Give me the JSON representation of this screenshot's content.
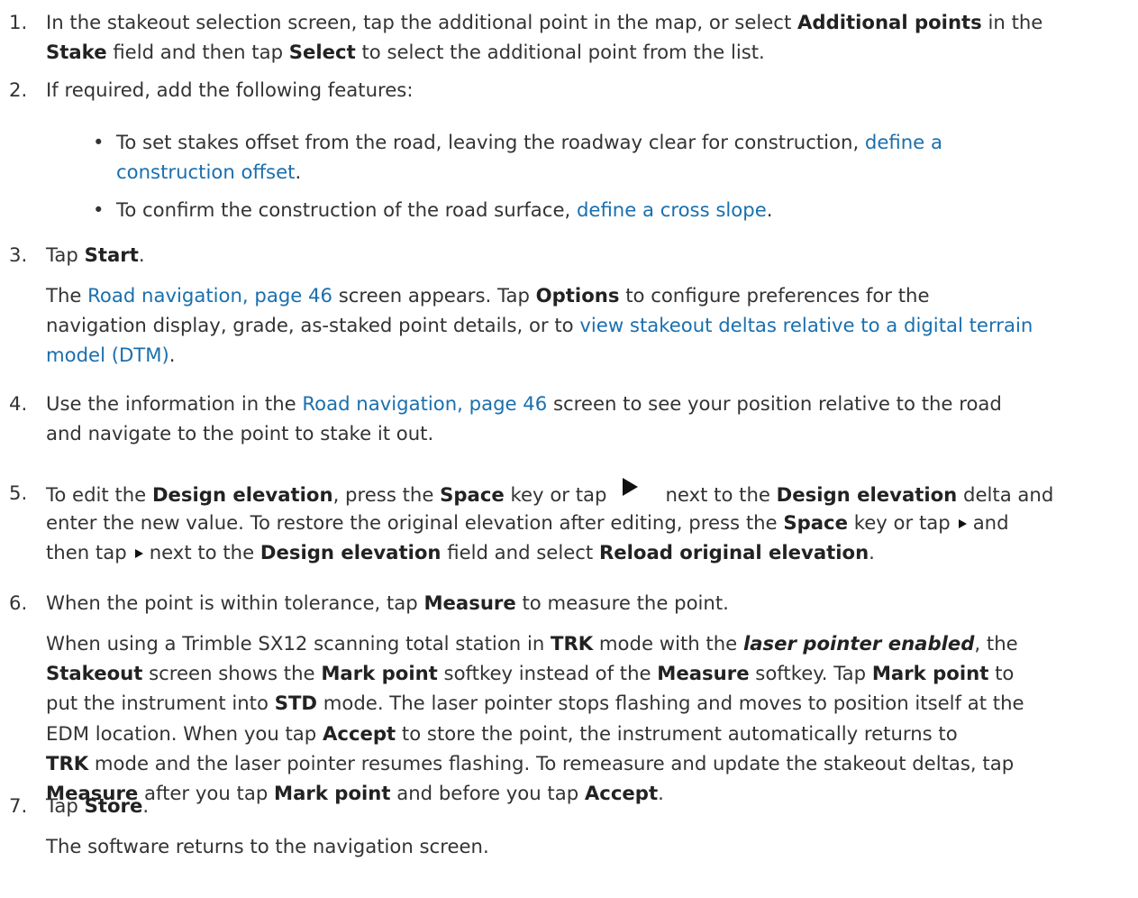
{
  "steps": [
    {
      "num": "1.",
      "lines": [
        [
          "In the stakeout selection screen, tap the additional point in the map, or select ",
          {
            "b": "Additional points"
          },
          " in the"
        ],
        [
          {
            "b": "Stake"
          },
          " field and then tap ",
          {
            "b": "Select"
          },
          " to select the additional point from the list."
        ]
      ]
    },
    {
      "num": "2.",
      "lines": [
        [
          "If required, add the following features:"
        ]
      ]
    },
    {
      "num": "3.",
      "lines": [
        [
          "Tap ",
          {
            "b": "Start"
          },
          "."
        ]
      ]
    },
    {
      "num": "",
      "lines": [
        [
          "The ",
          {
            "a": "Road navigation, page 46"
          },
          " screen appears. Tap ",
          {
            "b": "Options"
          },
          " to configure preferences for the"
        ],
        [
          "navigation display, grade, as-staked point details, or to ",
          {
            "a": "view stakeout deltas relative to a digital terrain"
          }
        ],
        [
          {
            "a": "model (DTM)"
          },
          "."
        ]
      ]
    },
    {
      "num": "4.",
      "lines": [
        [
          "Use the information in the ",
          {
            "a": "Road navigation, page 46"
          },
          " screen to see your position relative to the road"
        ],
        [
          "and navigate to the point to stake it out."
        ]
      ]
    },
    {
      "num": "5.",
      "lines": [
        [
          "To edit the ",
          {
            "b": "Design elevation"
          },
          ", press the ",
          {
            "b": "Space"
          },
          " key or tap",
          {
            "icon": "big"
          },
          "next to the ",
          {
            "b": "Design elevation"
          },
          " delta and"
        ],
        [
          "enter the new value. To restore the original elevation after editing, press the ",
          {
            "b": "Space"
          },
          " key or tap",
          {
            "icon": "small"
          },
          "and"
        ],
        [
          "then tap",
          {
            "icon": "small"
          },
          "next to the ",
          {
            "b": "Design elevation"
          },
          " field and select ",
          {
            "b": "Reload original elevation"
          },
          "."
        ]
      ]
    },
    {
      "num": "6.",
      "lines": [
        [
          "When the point is within tolerance, tap ",
          {
            "b": "Measure"
          },
          " to measure the point."
        ]
      ]
    },
    {
      "num": "",
      "lines": [
        [
          "When using a Trimble SX12 scanning total station in ",
          {
            "b": "TRK"
          },
          " mode with the ",
          {
            "bi": "laser pointer enabled"
          },
          ", the"
        ],
        [
          {
            "b": "Stakeout"
          },
          " screen shows the ",
          {
            "b": "Mark point"
          },
          " softkey instead of the ",
          {
            "b": "Measure"
          },
          " softkey. Tap ",
          {
            "b": "Mark point"
          },
          " to"
        ],
        [
          "put the instrument into ",
          {
            "b": "STD"
          },
          " mode. The laser pointer stops flashing and moves to position itself at the"
        ],
        [
          "EDM location. When you tap ",
          {
            "b": "Accept"
          },
          " to store the point, the instrument automatically returns to"
        ],
        [
          {
            "b": "TRK"
          },
          " mode and the laser pointer resumes flashing. To remeasure and update the stakeout deltas, tap"
        ],
        [
          {
            "b": "Measure"
          },
          " after you tap ",
          {
            "b": "Mark point"
          },
          " and before you tap ",
          {
            "b": "Accept"
          },
          "."
        ]
      ]
    },
    {
      "num": "7.",
      "lines": [
        [
          "Tap ",
          {
            "b": "Store"
          },
          "."
        ]
      ]
    },
    {
      "num": "",
      "lines": [
        [
          "The software returns to the navigation screen."
        ]
      ]
    }
  ],
  "bullets": [
    {
      "lines": [
        [
          "To set stakes offset from the road, leaving the roadway clear for construction, ",
          {
            "a": "define a"
          }
        ],
        [
          {
            "a": "construction offset"
          },
          "."
        ]
      ]
    },
    {
      "lines": [
        [
          "To confirm the construction of the road surface, ",
          {
            "a": "define a cross slope"
          },
          "."
        ]
      ]
    }
  ],
  "bullet_glyph": "•",
  "colors": {
    "text": "#333333",
    "bold": "#222222",
    "link": "#1a6fae",
    "icon": "#111111"
  },
  "icons": {
    "big": "right-triangle-icon",
    "small": "right-triangle-small-icon"
  }
}
